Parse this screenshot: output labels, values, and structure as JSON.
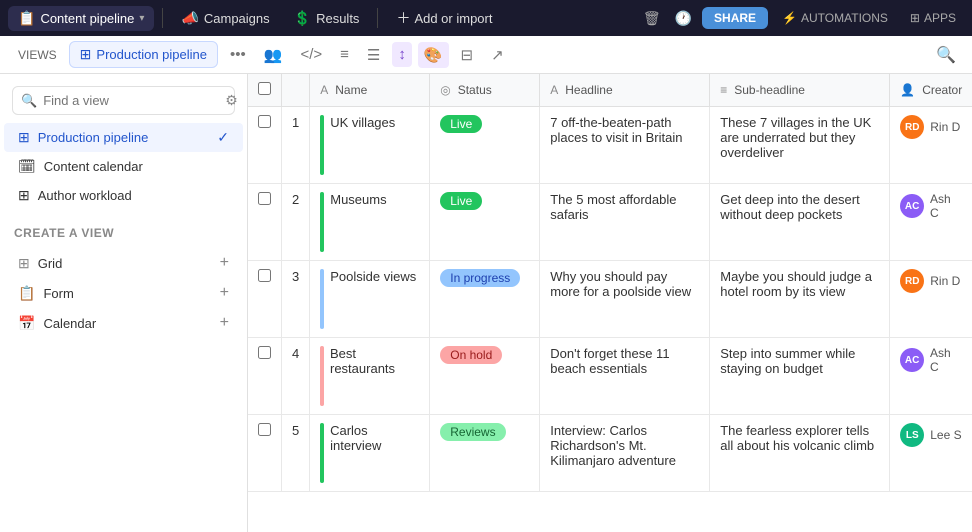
{
  "topNav": {
    "tabs": [
      {
        "id": "content-pipeline",
        "label": "Content pipeline",
        "emoji": "📋",
        "active": true
      },
      {
        "id": "campaigns",
        "label": "Campaigns",
        "emoji": "📣",
        "active": false
      },
      {
        "id": "results",
        "label": "Results",
        "emoji": "💲",
        "active": false
      }
    ],
    "addImport": "Add or import",
    "share": "SHARE",
    "automations": "AUTOMATIONS",
    "apps": "APPS"
  },
  "secondToolbar": {
    "viewsLabel": "VIEWS",
    "activeView": "Production pipeline"
  },
  "sidebar": {
    "searchPlaceholder": "Find a view",
    "items": [
      {
        "id": "production-pipeline",
        "label": "Production pipeline",
        "icon": "⊞",
        "active": true
      },
      {
        "id": "content-calendar",
        "label": "📅 Content calendar",
        "icon": "🗓",
        "active": false
      },
      {
        "id": "author-workload",
        "label": "Author workload",
        "icon": "⊞",
        "active": false
      }
    ],
    "createView": {
      "title": "Create a view",
      "options": [
        {
          "id": "grid",
          "label": "Grid",
          "icon": "⊞"
        },
        {
          "id": "form",
          "label": "Form",
          "icon": "📋"
        },
        {
          "id": "calendar",
          "label": "Calendar",
          "icon": "📅"
        }
      ]
    }
  },
  "table": {
    "columns": [
      {
        "id": "checkbox",
        "label": ""
      },
      {
        "id": "num",
        "label": ""
      },
      {
        "id": "name",
        "label": "Name",
        "icon": "A"
      },
      {
        "id": "status",
        "label": "Status",
        "icon": "◎"
      },
      {
        "id": "headline",
        "label": "Headline",
        "icon": "A"
      },
      {
        "id": "subheadline",
        "label": "Sub-headline",
        "icon": "≡"
      },
      {
        "id": "creator",
        "label": "Creator",
        "icon": "👤"
      }
    ],
    "rows": [
      {
        "num": "1",
        "name": "UK villages",
        "status": "Live",
        "statusClass": "status-live",
        "barClass": "bar-green",
        "headline": "7 off-the-beaten-path places to visit in Britain",
        "subheadline": "These 7 villages in the UK are underrated but they overdeliver",
        "creator": "Rin D",
        "avatarClass": "avatar-rin",
        "avatarInitials": "RD"
      },
      {
        "num": "2",
        "name": "Museums",
        "status": "Live",
        "statusClass": "status-live",
        "barClass": "bar-green",
        "headline": "The 5 most affordable safaris",
        "subheadline": "Get deep into the desert without deep pockets",
        "creator": "Ash C",
        "avatarClass": "avatar-ash",
        "avatarInitials": "AC"
      },
      {
        "num": "3",
        "name": "Poolside views",
        "status": "In progress",
        "statusClass": "status-inprogress",
        "barClass": "bar-blue",
        "headline": "Why you should pay more for a poolside view",
        "subheadline": "Maybe you should judge a hotel room by its view",
        "creator": "Rin D",
        "avatarClass": "avatar-rin",
        "avatarInitials": "RD"
      },
      {
        "num": "4",
        "name": "Best restaurants",
        "status": "On hold",
        "statusClass": "status-onhold",
        "barClass": "bar-pink",
        "headline": "Don't forget these 11 beach essentials",
        "subheadline": "Step into summer while staying on budget",
        "creator": "Ash C",
        "avatarClass": "avatar-ash",
        "avatarInitials": "AC"
      },
      {
        "num": "5",
        "name": "Carlos interview",
        "status": "Reviews",
        "statusClass": "status-reviews",
        "barClass": "bar-green",
        "headline": "Interview: Carlos Richardson's Mt. Kilimanjaro adventure",
        "subheadline": "The fearless explorer tells all about his volcanic climb",
        "creator": "Lee S",
        "avatarClass": "avatar-lee",
        "avatarInitials": "LS"
      }
    ]
  }
}
